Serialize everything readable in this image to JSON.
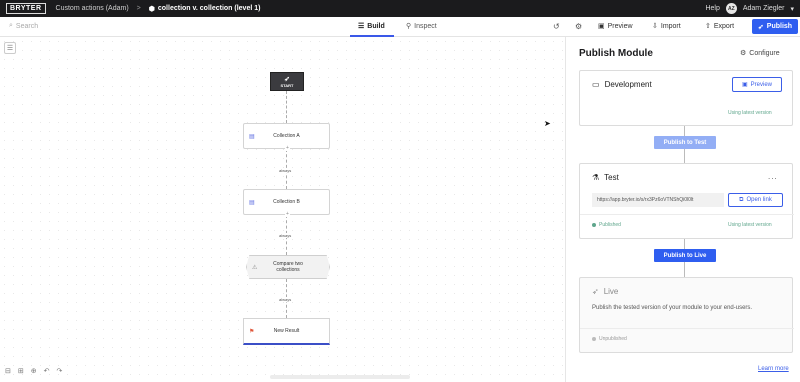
{
  "topbar": {
    "logo": "BRYTER",
    "crumb": "Custom actions (Adam)",
    "crumb_sep": ">",
    "current": "collection v. collection (level 1)",
    "help": "Help",
    "avatar": "AZ",
    "user": "Adam Ziegler"
  },
  "toolbar": {
    "search_placeholder": "Search",
    "tabs": [
      {
        "label": "Build"
      },
      {
        "label": "Inspect"
      }
    ],
    "preview": "Preview",
    "import": "Import",
    "export": "Export",
    "publish": "Publish"
  },
  "flow": {
    "start": "START",
    "nodes": [
      "Collection A",
      "Collection B"
    ],
    "decision": "Compare two collections",
    "edge_label": "always",
    "result": "New Result"
  },
  "panel": {
    "title": "Publish Module",
    "configure": "Configure",
    "development": {
      "title": "Development",
      "preview": "Preview",
      "status": "Using latest version"
    },
    "publish_to_test": "Publish to Test",
    "test": {
      "title": "Test",
      "more": "...",
      "url": "https://app.bryter.io/s/rx3Pz6oVTNShQi0l0lt",
      "open_link": "Open link",
      "published": "Published",
      "status": "Using latest version"
    },
    "publish_to_live": "Publish to Live",
    "live": {
      "title": "Live",
      "description": "Publish the tested version of your module to your end-users.",
      "unpublished": "Unpublished"
    },
    "learn_more": "Learn more"
  },
  "colors": {
    "accent": "#2f5ef0",
    "topbar": "#1b1b1d",
    "success": "#5fa68c"
  }
}
